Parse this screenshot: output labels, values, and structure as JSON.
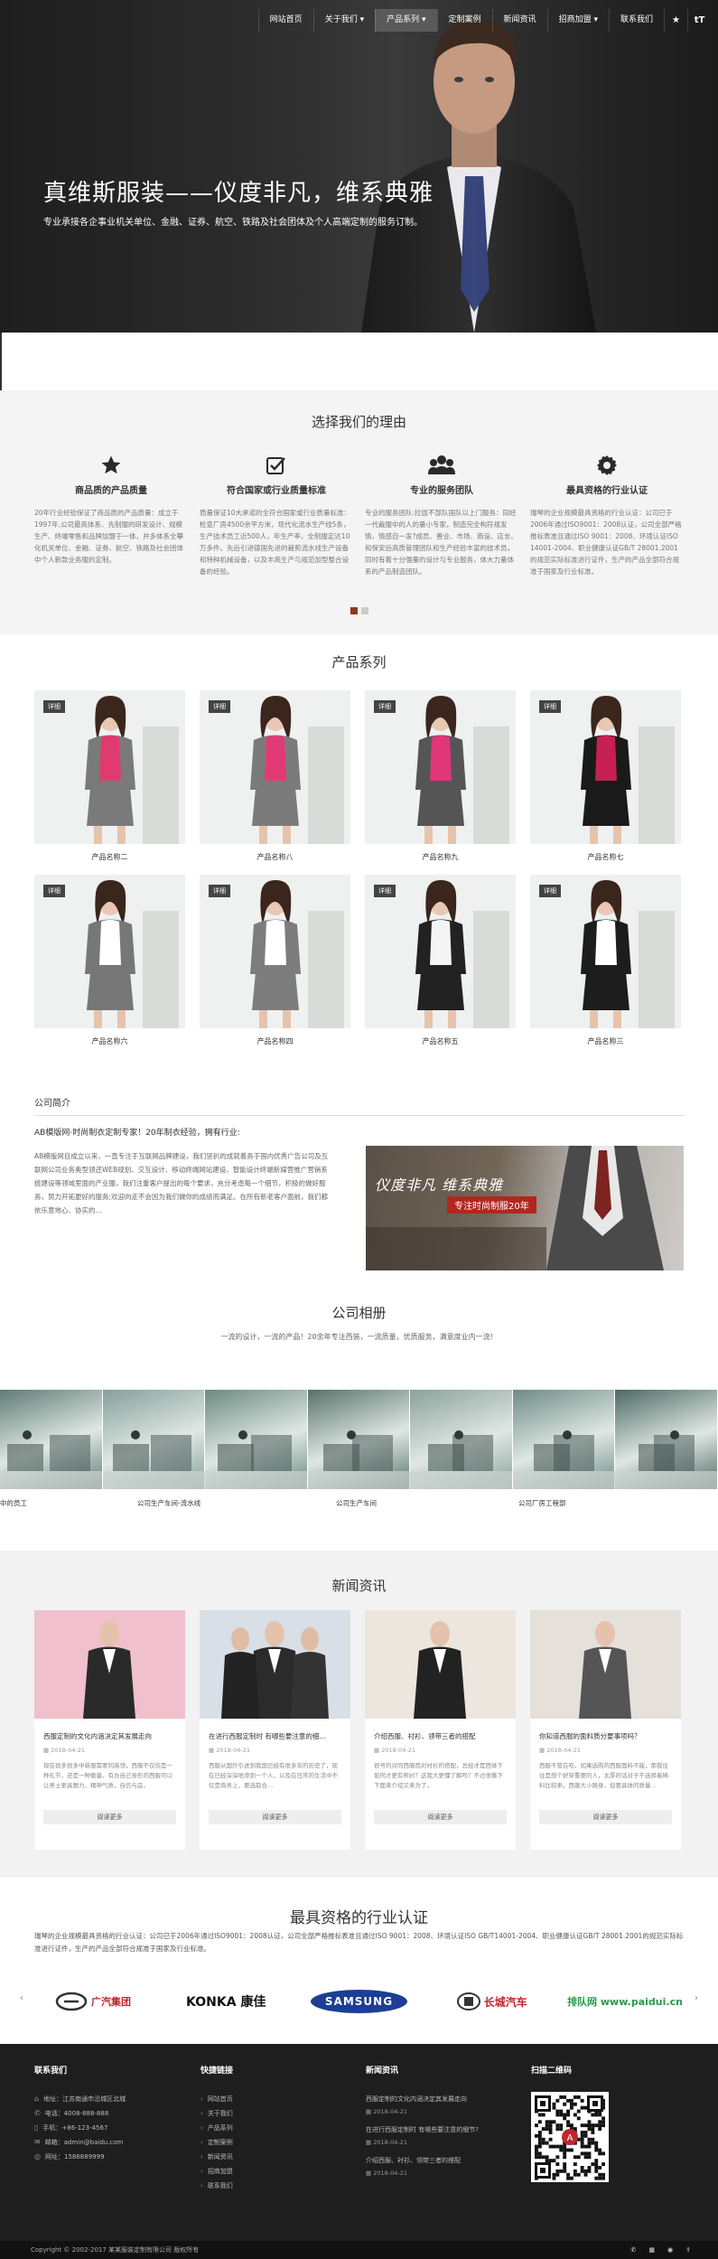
{
  "nav": {
    "items": [
      "网站首页",
      "关于我们",
      "产品系列",
      "定制案例",
      "新闻资讯",
      "招商加盟",
      "联系我们"
    ],
    "active": "产品系列",
    "icons": [
      "star-icon",
      "font-size-icon"
    ]
  },
  "hero": {
    "title": "真维斯服装——仪度非凡，维系典雅",
    "subtitle": "专业承接各企事业机关单位、金融、证券、航空、铁路及社会团体及个人高端定制的服务订制。"
  },
  "reasons": {
    "title": "选择我们的理由",
    "items": [
      {
        "icon": "star-icon",
        "title": "商品质的产品质量",
        "desc": "20年行业经验保证了商品质的产品质量：成立于1997年,公司最高体系、先制服的研发设计、规模生产、终端零售和品牌加盟于一体，并多体系全攀化机关单位、金融、证券、航空、铁路及社会团体中个人新款业务服的定制。"
      },
      {
        "icon": "checkbox-icon",
        "title": "符合国家或行业质量标准",
        "desc": "质量保证10大承诺的全符合国家或行业质量标准：检查厂房4500余平方米，现代化流水生产线5条，生产技术员工近500人，年生产率，全制服定达10万多件。先后引进德国先进的裁剪流水线生产设备和特种机械设备，以及丰高生产与规范加型整合设备的经验。"
      },
      {
        "icon": "team-icon",
        "title": "专业的服务团队",
        "desc": "专业的服务团队:拉拢不部队国队以上门服务：同经一代裁服中的人的量小专家，制造完全构符规发情，情感自一发?成员、善业、市场、商设、店长、和保安后高质管理团队和生产经验丰富的技术员，同时有着十分强量的设计与专业服务，体大力量体系的产品制造团队。"
      },
      {
        "icon": "gear-badge-icon",
        "title": "最具资格的行业认证",
        "desc": "瑞琴的企业规模最具资格的行业认证：公司已于2006年通过ISO9001：2008认证，公司全部严格推标表准且通过ISO 9001：2008、环境认证ISO 14001-2004、职业健康认证GB/T 28001.2001的规范实际标准进行证件，生产的产品全部符合规准于国家及行业标准。"
      }
    ]
  },
  "products": {
    "title": "产品系列",
    "tag": "详细",
    "items": [
      {
        "name": "产品名称二",
        "colors": [
          "#e13a6e",
          "#7a7a7a"
        ]
      },
      {
        "name": "产品名称八",
        "colors": [
          "#e23a74",
          "#7b7b7b"
        ]
      },
      {
        "name": "产品名称九",
        "colors": [
          "#e1367a",
          "#555555"
        ]
      },
      {
        "name": "产品名称七",
        "colors": [
          "#c81f52",
          "#1a1a1a"
        ]
      },
      {
        "name": "产品名称六",
        "colors": [
          "#ffffff",
          "#777777"
        ]
      },
      {
        "name": "产品名称四",
        "colors": [
          "#ffffff",
          "#7d7d7d"
        ]
      },
      {
        "name": "产品名称五",
        "colors": [
          "#f4f4f4",
          "#222222"
        ]
      },
      {
        "name": "产品名称三",
        "colors": [
          "#ffffff",
          "#1d1d1d"
        ]
      }
    ]
  },
  "about": {
    "heading": "公司简介",
    "sub": "AB模版网·时尚制衣定制专家！20年制衣经验，拥有行业:",
    "text": "AB模版网自成立以来，一直专注于互联网品牌建设，我们坚扒的成就着务于国内优秀广告公司及互联网公司业务奥型领还WEB规划、交互设计、移动终端网站建设、智能设计终端新媒营推广营销系统建设等领域里面的产业服，我们注重客户提出的每个要求，充分考虑每一个细节，积极的做好服务，努力开拓更好的服务;欢迎向走不会因为我们做你的成绩而满足。在所有新老客户面前，我们都依乐意地心、协实的...",
    "banner_title": "仪度非凡 维系典雅",
    "banner_sub": "专注时尚制服20年"
  },
  "album": {
    "title": "公司相册",
    "intro": "一流的设计，一流的产品！20余年专注西装，一流质量，优质服务，满意度业内一流！",
    "captions": [
      "中的员工",
      "公司生产车间-流水线",
      "公司生产车间",
      "公司厂房工程部"
    ],
    "photo_colors": [
      "#5f7c74",
      "#85a099",
      "#6b8a80",
      "#577269",
      "#8ba19a",
      "#6e8c84",
      "#4d6a62"
    ]
  },
  "news": {
    "title": "新闻资讯",
    "more": "阅读更多",
    "items": [
      {
        "title": "西服定制的文化内涵决定其发展走向",
        "date": "2018-04-21",
        "excerpt": "现在很多很多中新服需要同高领，西服不仅仅是一种礼节，还是一种衡量。有办自己身形的西服可以让男士更具魅力，精神气质，自信与品，"
      },
      {
        "title": "在进行西服定制时 有哪些要注意的细...",
        "date": "2018-04-21",
        "excerpt": "西服从国外引进到我国已经有很多年的历史了，现在已经深深地渗到一个人，以及在日常的生活中不仅是商务上，要选取合…"
      },
      {
        "title": "介绍西服、衬衫、领带三者的搭配",
        "date": "2018-04-21",
        "excerpt": "很号的对同西服而对衬衫的搭配，总经才是西体下如何才更有帮衬？这我大更懂了解吗？不过很像下下面来介绍又来为了，"
      },
      {
        "title": "你知道西服的面料质分要事项吗？",
        "date": "2018-04-21",
        "excerpt": "西服不管在吃，如果选购的西服面料不能，那我往往是想个好穿重要的人，太厚的话对于不选择着稀料比较来，西服大小随身，但要具体的质量…"
      }
    ]
  },
  "cert": {
    "title": "最具资格的行业认证",
    "text": "瑞琴的企业规模最具资格的行业认证：公司已于2006年通过ISO9001：2008认证，公司全部严格推标表准且通过ISO 9001：2008、环境认证ISO GB/T14001-2004、职业健康认证GB/T 28001.2001的规范实际标准进行证件，生产的产品全部符合规准于国家及行业标准。",
    "logos": [
      "广汽集团",
      "KONKA 康佳",
      "SAMSUNG",
      "长城汽车",
      "排队网 www.paidui.cn"
    ]
  },
  "footer": {
    "contact": {
      "title": "联系我们",
      "rows": [
        {
          "icon": "location-icon",
          "text": "地址：江苏南通市沿城区北城"
        },
        {
          "icon": "phone-icon",
          "text": "电话：4008-888-888"
        },
        {
          "icon": "mobile-icon",
          "text": "手机：+86-123-4567"
        },
        {
          "icon": "mail-icon",
          "text": "邮箱：admin@baidu.com"
        },
        {
          "icon": "qq-icon",
          "text": "网址：1586889999"
        }
      ]
    },
    "links": {
      "title": "快捷链接",
      "items": [
        "网站首页",
        "关于我们",
        "产品系列",
        "定制案例",
        "新闻资讯",
        "招商加盟",
        "联系我们"
      ]
    },
    "news": {
      "title": "新闻资讯",
      "items": [
        {
          "title": "西服定制的文化内涵决定其发展走向",
          "date": "2018-04-21"
        },
        {
          "title": "在进行西服定制时 有哪些要注意的细节?",
          "date": "2018-04-21"
        },
        {
          "title": "介绍西服、衬衫、领带三者的搭配",
          "date": "2018-04-21"
        }
      ]
    },
    "qr": {
      "title": "扫描二维码"
    },
    "copyright": "Copyright © 2002-2017 某某服装定制有限公司 版权所有"
  }
}
